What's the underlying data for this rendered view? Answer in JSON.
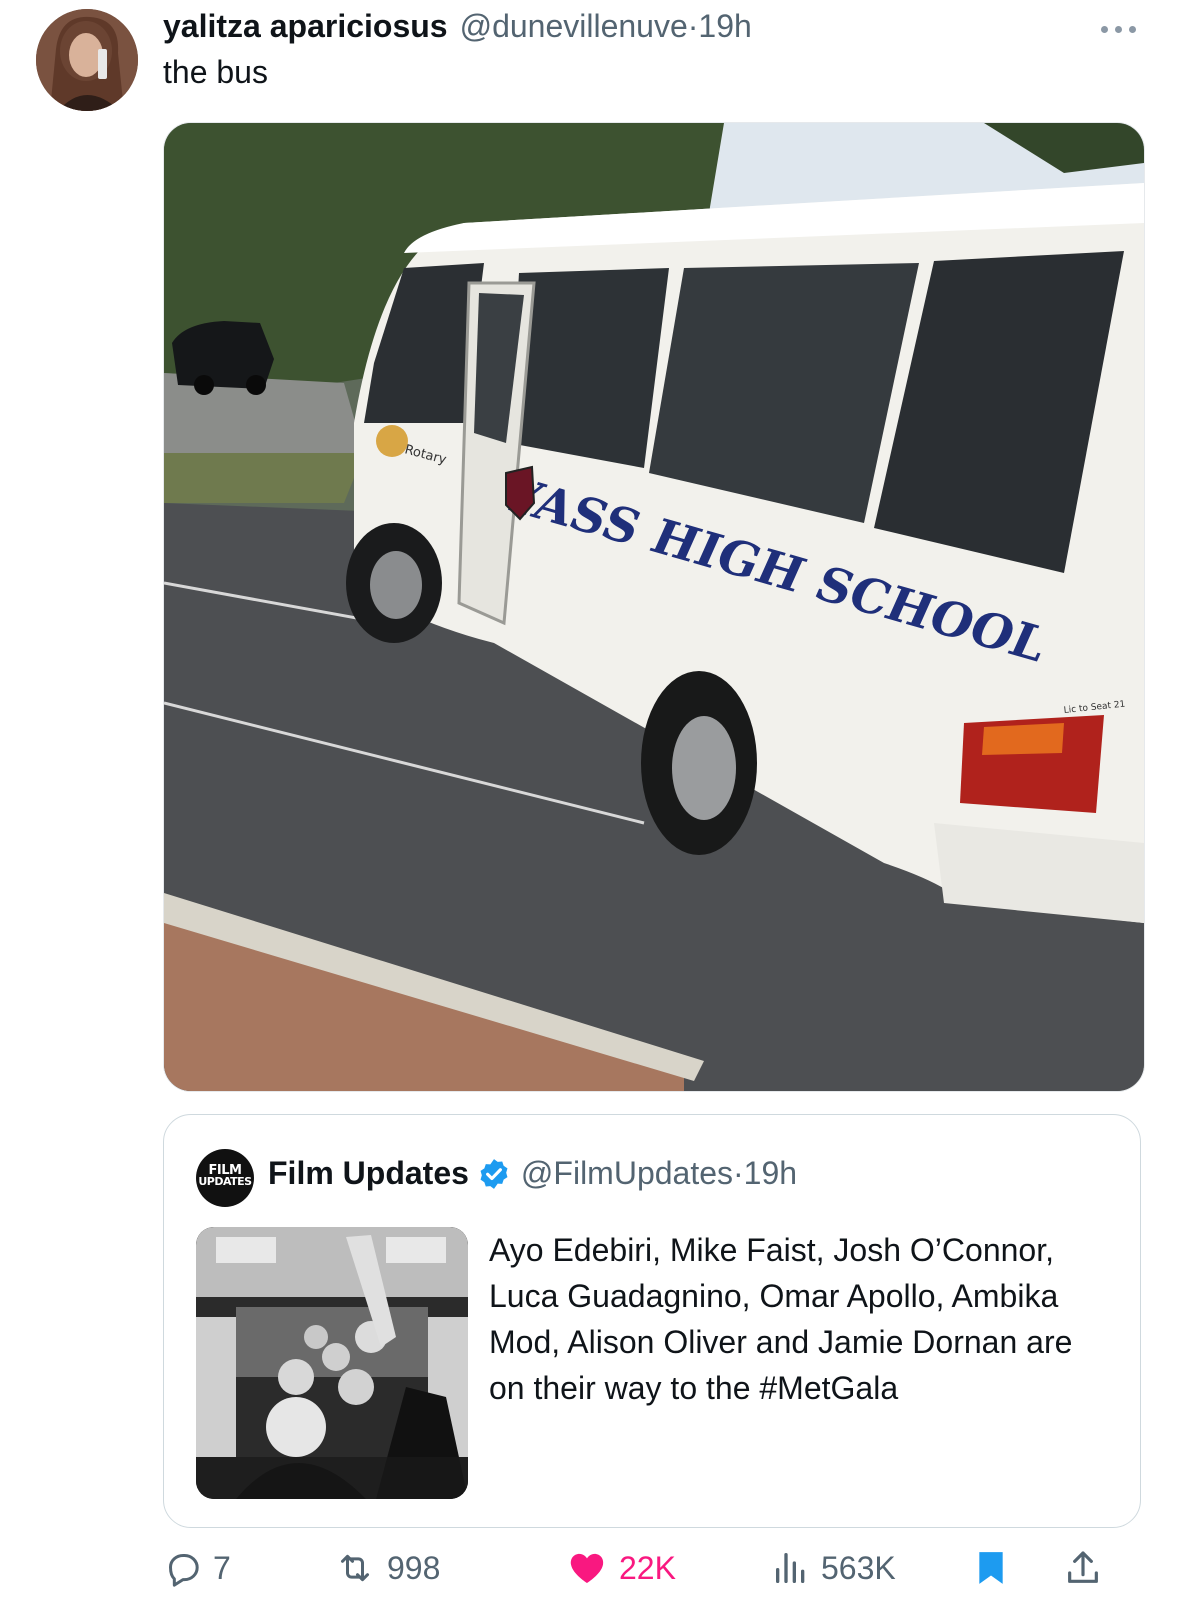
{
  "post": {
    "display_name": "yalitza apariciosus",
    "handle": "@dunevillenuve",
    "time_sep": " · ",
    "time": "19h",
    "text": "the bus",
    "image": {
      "bus_name": "YASS HIGH SCHOOL",
      "sticker": "Rotary",
      "seat_label": "Lic to Seat 21"
    }
  },
  "quote": {
    "avatar_text_line1": "FILM",
    "avatar_text_line2": "UPDATES",
    "display_name": "Film Updates",
    "handle": "@FilmUpdates",
    "time_sep": " · ",
    "time": "19h",
    "text": "Ayo Edebiri, Mike Faist, Josh O’Connor, Luca Guadagnino, Omar Apollo, Ambika Mod, Alison Oliver and Jamie Dornan are on their way to the #MetGala"
  },
  "actions": {
    "replies": "7",
    "reposts": "998",
    "likes": "22K",
    "views": "563K"
  },
  "colors": {
    "text_primary": "#0f1419",
    "text_secondary": "#536471",
    "like": "#f91880",
    "accent": "#1d9bf0"
  },
  "icons": [
    "more-dots-icon",
    "verified-badge-icon",
    "reply-icon",
    "repost-icon",
    "heart-icon",
    "views-icon",
    "bookmark-icon",
    "share-icon"
  ]
}
